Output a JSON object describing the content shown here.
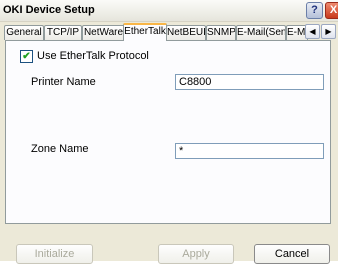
{
  "window": {
    "title": "OKI Device Setup",
    "help_label": "?",
    "close_label": "X"
  },
  "tabs": [
    {
      "label": "General",
      "active": false
    },
    {
      "label": "TCP/IP",
      "active": false
    },
    {
      "label": "NetWare",
      "active": false
    },
    {
      "label": "EtherTalk",
      "active": true
    },
    {
      "label": "NetBEUI",
      "active": false
    },
    {
      "label": "SNMP",
      "active": false
    },
    {
      "label": "E-Mail(Send)",
      "active": false
    },
    {
      "label": "E-Mail(",
      "active": false
    }
  ],
  "scroll": {
    "left": "◀",
    "right": "▶"
  },
  "ethertalk": {
    "use_protocol_label": "Use EtherTalk Protocol",
    "use_protocol_checked": true,
    "check_mark": "✔",
    "printer_name_label": "Printer Name",
    "printer_name_value": "C8800",
    "zone_name_label": "Zone Name",
    "zone_name_value": "*"
  },
  "buttons": {
    "initialize": "Initialize",
    "apply": "Apply",
    "cancel": "Cancel"
  }
}
